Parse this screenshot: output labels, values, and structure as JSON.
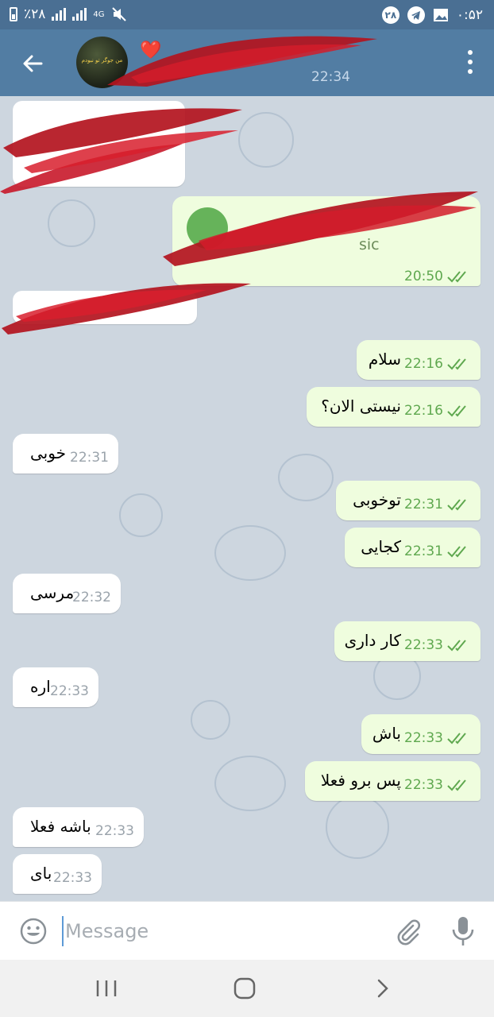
{
  "status_bar": {
    "battery": "٪۲۸",
    "network": "4G",
    "notification_count": "۲۸",
    "clock": "۰:۵۲"
  },
  "header": {
    "contact_name": "❤️",
    "last_seen": "22:34",
    "avatar_text": "من جوگر تو نبودم"
  },
  "music_message": {
    "subtitle": "sic",
    "time": "20:50"
  },
  "messages": [
    {
      "dir": "out",
      "text": "سلام",
      "time": "22:16"
    },
    {
      "dir": "out",
      "text": "نیستی الان؟",
      "time": "22:16"
    },
    {
      "dir": "in",
      "text": "خوبی",
      "time": "22:31"
    },
    {
      "dir": "out",
      "text": "توخوبی",
      "time": "22:31"
    },
    {
      "dir": "out",
      "text": "کجایی",
      "time": "22:31"
    },
    {
      "dir": "in",
      "text": "مرسی",
      "time": "22:32"
    },
    {
      "dir": "out",
      "text": "کار داری",
      "time": "22:33"
    },
    {
      "dir": "in",
      "text": "اره",
      "time": "22:33"
    },
    {
      "dir": "out",
      "text": "باش",
      "time": "22:33"
    },
    {
      "dir": "out",
      "text": "پس برو فعلا",
      "time": "22:33"
    },
    {
      "dir": "in",
      "text": "باشه فعلا",
      "time": "22:33"
    },
    {
      "dir": "in",
      "text": "بای",
      "time": "22:33"
    }
  ],
  "composer": {
    "placeholder": "Message"
  },
  "colors": {
    "header": "#527da3",
    "status_bar": "#4a6f93",
    "outgoing_bubble": "#effdde",
    "incoming_bubble": "#ffffff",
    "chat_bg": "#cdd6df",
    "read_ticks": "#5fa84f",
    "redaction": "#b3141e"
  }
}
